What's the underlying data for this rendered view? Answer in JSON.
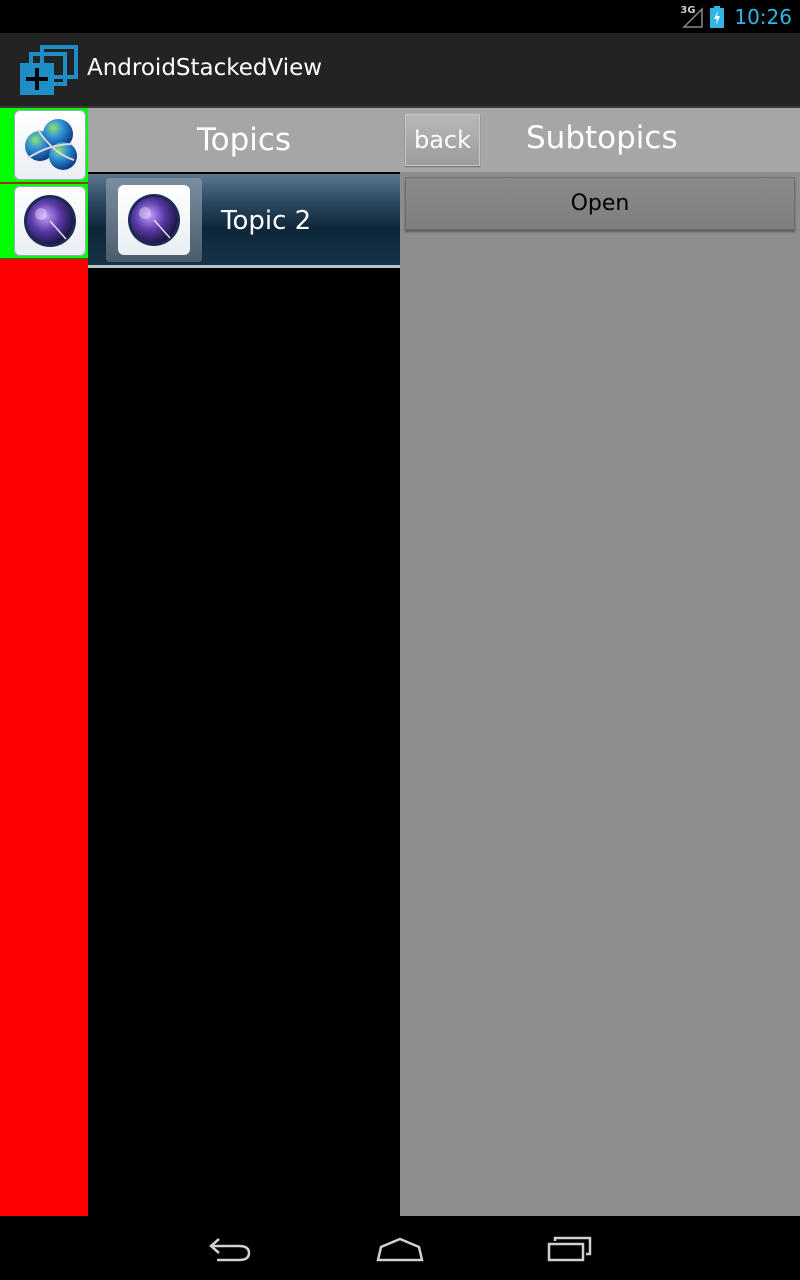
{
  "status_bar": {
    "network": "3G",
    "time": "10:26",
    "clock_color": "#33b5e5"
  },
  "action_bar": {
    "title": "AndroidStackedView",
    "icon": "stacked-cards-plus-icon"
  },
  "rail": {
    "background_color": "#ff0000",
    "item_color": "#00ff00",
    "items": [
      {
        "icon": "globe-network-icon"
      },
      {
        "icon": "radar-sphere-icon"
      }
    ]
  },
  "topics": {
    "header": "Topics",
    "items": [
      {
        "label": "Topic 2",
        "icon": "radar-sphere-icon",
        "selected": true
      }
    ]
  },
  "subtopics": {
    "back_label": "back",
    "header": "Subtopics",
    "open_label": "Open"
  },
  "nav_bar": {
    "buttons": [
      "back-icon",
      "home-icon",
      "recent-apps-icon"
    ]
  }
}
